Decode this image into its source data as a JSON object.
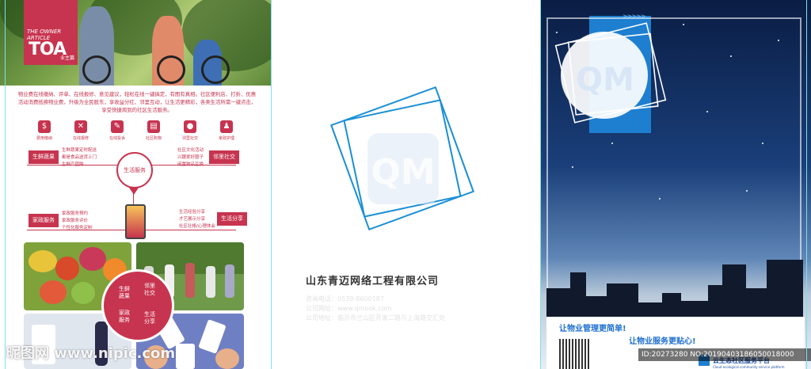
{
  "left_panel": {
    "badge": {
      "line1": "THE OWNER",
      "line2": "ARTICLE",
      "big": "TOA",
      "small": "业主篇"
    },
    "intro": "物业费在线缴纳、评单、在线报修、意见建议，轻松在线一键搞定，有图有真相。社区便利店、打折、优惠活动消费抵换物业费，升级为全民股东，享收益分红、邻里互动，让生活更精彩，各类生活所需一键点击，享受快捷周到的社区生活服务。",
    "icons": [
      {
        "label": "费用缴纳",
        "glyph": "$",
        "icon": "payment-icon"
      },
      {
        "label": "在线报修",
        "glyph": "✕",
        "icon": "repair-tools-icon"
      },
      {
        "label": "在线投诉",
        "glyph": "✎",
        "icon": "complaint-form-icon"
      },
      {
        "label": "社区购物",
        "glyph": "▤",
        "icon": "shopping-cart-icon"
      },
      {
        "label": "邻里社交",
        "glyph": "●",
        "icon": "social-people-icon"
      },
      {
        "label": "家政护理",
        "glyph": "♟",
        "icon": "housekeeping-icon"
      }
    ],
    "center_label": "生活服务",
    "services": [
      {
        "tag": "生鲜蔬果",
        "lines": [
          "生鲜蔬果定时配送",
          "都是食品送货上门",
          "生鲜产团购"
        ]
      },
      {
        "tag": "邻里社交",
        "lines": [
          "社区文化活动",
          "兴趣爱好圈子",
          "闲置物品互换"
        ]
      },
      {
        "tag": "家政服务",
        "lines": [
          "家政服务预约",
          "家政服务评价",
          "个性化服务定制"
        ]
      },
      {
        "tag": "生活分享",
        "lines": [
          "生活经验分享",
          "才艺展示分享",
          "社区壮格/心理体会"
        ]
      }
    ],
    "circle_labels": [
      "生鲜",
      "蔬果",
      "邻里",
      "社交",
      "家政",
      "服务",
      "生活",
      "分享"
    ],
    "watermark": "昵图网 www.nipic.com"
  },
  "middle_panel": {
    "company": "山东青迈网络工程有限公司",
    "contacts": [
      "咨询电话：0539-8600187",
      "公司网址：www.qmook.com",
      "公司地址：临沂市兰山区开发二路与上海路交汇处"
    ]
  },
  "right_panel": {
    "slogan1": "让物业管理更简单!",
    "slogan2": "让物业服务更贴心!",
    "platform": "云生态社区服务平台",
    "platform_sub": "Cloud ecological community service platform",
    "id_text": "ID:20273280 NO:20190403186050018000"
  },
  "colors": {
    "accent_red": "#c7344f",
    "accent_blue": "#1e7fd0"
  }
}
